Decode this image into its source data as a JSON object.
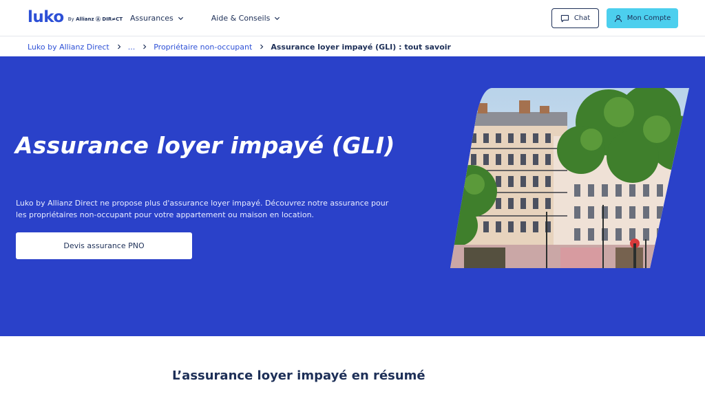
{
  "header": {
    "logo_text": "luko",
    "logo_by": "By",
    "logo_partner": "Allianz Ⓐ DIR≠CT",
    "nav": [
      {
        "label": "Assurances"
      },
      {
        "label": "Aide & Conseils"
      }
    ],
    "chat_label": "Chat",
    "account_label": "Mon Compte"
  },
  "breadcrumb": {
    "items": [
      "Luko by Allianz Direct",
      "...",
      "Propriétaire non-occupant"
    ],
    "current": "Assurance loyer impayé (GLI) : tout savoir"
  },
  "hero": {
    "title": "Assurance loyer impayé (GLI)",
    "description": "Luko by Allianz Direct ne propose plus d'assurance loyer impayé. Découvrez notre assurance pour les propriétaires non-occupant pour votre appartement ou maison en location.",
    "cta_label": "Devis assurance PNO"
  },
  "summary": {
    "title": "L’assurance loyer impayé en résumé"
  },
  "colors": {
    "brand_blue": "#2a41c9",
    "link_blue": "#2d50d6",
    "accent_cyan": "#4ccfee",
    "navy": "#1d2f57"
  },
  "icons": [
    "chevron-down-icon",
    "chat-bubble-icon",
    "user-icon",
    "chevron-right-icon"
  ]
}
